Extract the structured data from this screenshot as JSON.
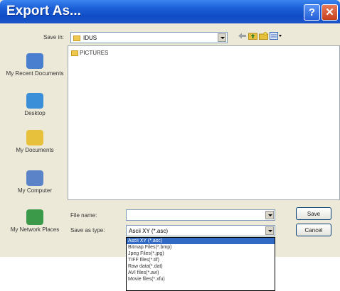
{
  "window": {
    "title": "Export As...",
    "help_glyph": "?",
    "close_glyph": "✕"
  },
  "toolbar": {
    "save_in_label": "Save in:",
    "save_in_value": "IDUS",
    "icons": [
      "back-icon",
      "up-folder-icon",
      "new-folder-icon",
      "views-menu-icon"
    ]
  },
  "places": [
    {
      "label": "My Recent Documents",
      "icon": "recent-documents-icon",
      "color": "#4a7fd0"
    },
    {
      "label": "Desktop",
      "icon": "desktop-icon",
      "color": "#3b8fd8"
    },
    {
      "label": "My Documents",
      "icon": "my-documents-icon",
      "color": "#e8c13c"
    },
    {
      "label": "My Computer",
      "icon": "my-computer-icon",
      "color": "#5a83c8"
    },
    {
      "label": "My Network Places",
      "icon": "network-places-icon",
      "color": "#3a9a4a"
    }
  ],
  "files": [
    {
      "name": "PICTURES",
      "icon": "folder-icon"
    }
  ],
  "form": {
    "filename_label": "File name:",
    "filename_value": "",
    "type_label": "Save as type:",
    "type_value": "Ascii XY (*.asc)",
    "save_label": "Save",
    "cancel_label": "Cancel"
  },
  "type_options": [
    "Ascii XY (*.asc)",
    "Bitmap Files(*.bmp)",
    "Jpeg Files(*.jpg)",
    "TIFF files(*.tif)",
    "Raw data(*.dat)",
    "AVI files(*.avi)",
    "Movie files(*.xfu)"
  ],
  "colors": {
    "title_bar": "#1b5fd6",
    "selected": "#316ac5",
    "close_button": "#c6401c"
  }
}
